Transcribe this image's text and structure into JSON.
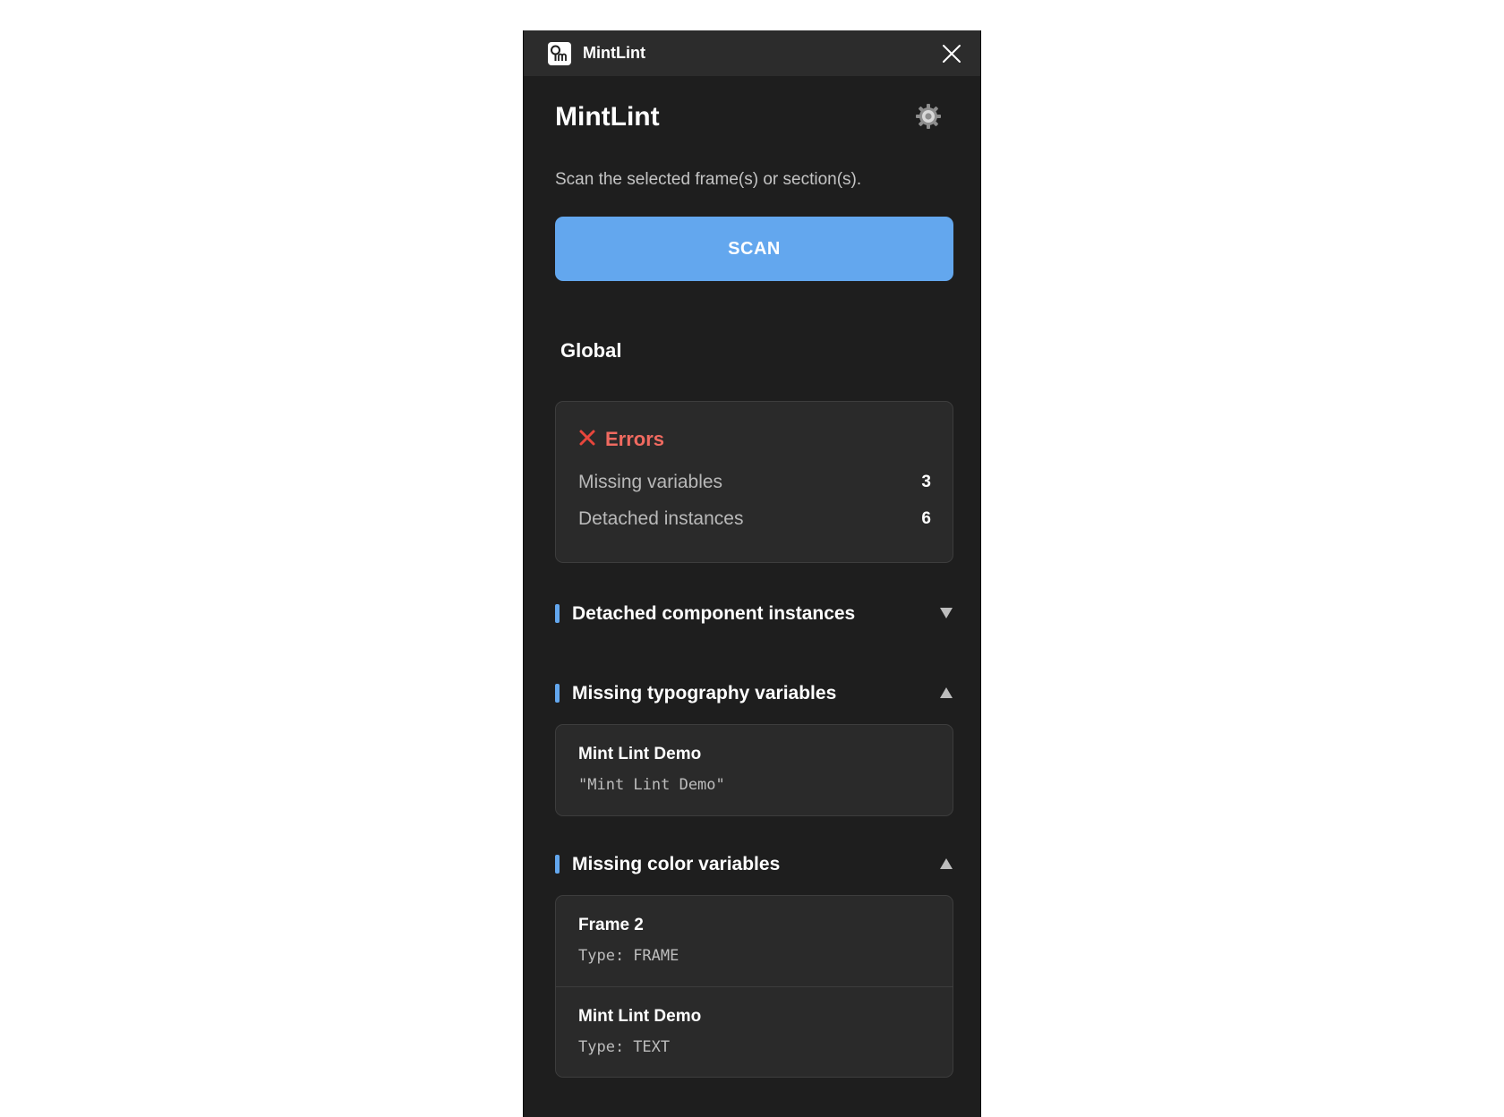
{
  "window": {
    "title": "MintLint",
    "icon": "mintlint-logo-icon",
    "close_icon": "close-icon"
  },
  "header": {
    "title": "MintLint",
    "settings_icon": "gear-icon"
  },
  "scan": {
    "description": "Scan the selected frame(s) or section(s).",
    "button_label": "SCAN",
    "button_color": "#63a7ee"
  },
  "global": {
    "title": "Global",
    "errors": {
      "label": "Errors",
      "icon": "x-error-icon",
      "color": "#f06a60",
      "rows": [
        {
          "label": "Missing variables",
          "value": "3"
        },
        {
          "label": "Detached instances",
          "value": "6"
        }
      ]
    }
  },
  "sections": [
    {
      "title": "Detached component instances",
      "expanded": false,
      "chevron_icon": "chevron-down-icon",
      "items": []
    },
    {
      "title": "Missing typography variables",
      "expanded": true,
      "chevron_icon": "chevron-up-icon",
      "items": [
        {
          "title": "Mint Lint Demo",
          "detail": "\"Mint Lint Demo\""
        }
      ]
    },
    {
      "title": "Missing color variables",
      "expanded": true,
      "chevron_icon": "chevron-up-icon",
      "items": [
        {
          "title": "Frame 2",
          "type_key": "Type:",
          "type_value": "FRAME"
        },
        {
          "title": "Mint Lint Demo",
          "type_key": "Type:",
          "type_value": "TEXT"
        }
      ]
    }
  ]
}
